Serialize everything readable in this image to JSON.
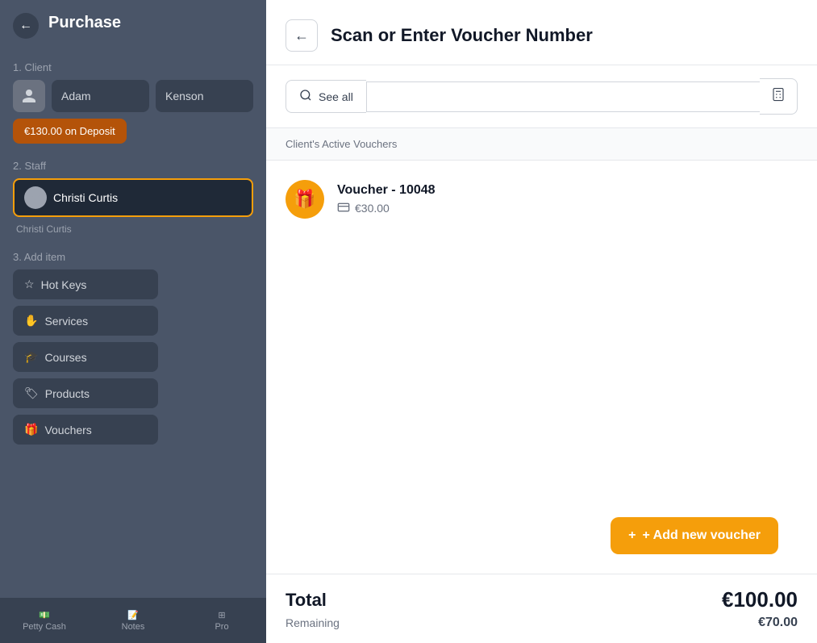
{
  "bg": {
    "back_icon": "←",
    "title": "Purchase",
    "section1_label": "1. Client",
    "client_first_name": "Adam",
    "client_last_name": "Kenson",
    "deposit_label": "€130.00 on Deposit",
    "section2_label": "2. Staff",
    "staff_name": "Christi Curtis",
    "section3_label": "3. Add item",
    "items": [
      {
        "icon": "☆",
        "label": "Hot Keys"
      },
      {
        "icon": "✋",
        "label": "Services"
      },
      {
        "icon": "🎓",
        "label": "Courses"
      },
      {
        "icon": "🏷",
        "label": "Products"
      },
      {
        "icon": "🎁",
        "label": "Vouchers"
      }
    ],
    "bottom_items": [
      {
        "icon": "💵",
        "label": "Petty Cash"
      },
      {
        "icon": "📝",
        "label": "Notes"
      },
      {
        "icon": "⊞",
        "label": "Pro"
      }
    ]
  },
  "modal": {
    "back_icon": "←",
    "title": "Scan or Enter Voucher Number",
    "see_all_label": "See all",
    "search_placeholder": "",
    "calc_icon": "⊞",
    "section_label": "Client's Active Vouchers",
    "vouchers": [
      {
        "icon": "🎁",
        "name": "Voucher - 10048",
        "amount": "€30.00"
      }
    ],
    "add_voucher_label": "+ Add new voucher",
    "footer": {
      "total_label": "Total",
      "total_value": "€100.00",
      "remaining_label": "Remaining",
      "remaining_value": "€70.00"
    }
  }
}
